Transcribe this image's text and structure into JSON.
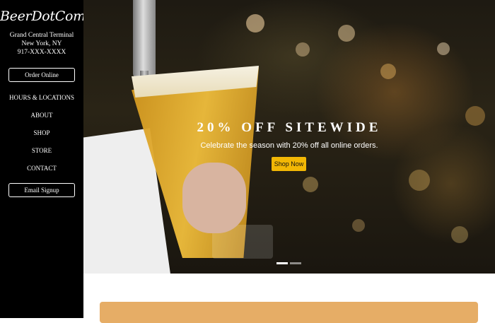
{
  "sidebar": {
    "logo": "BeerDotCom",
    "address_line1": "Grand Central Terminal",
    "address_line2": "New York, NY",
    "phone": "917-XXX-XXXX",
    "order_button": "Order Online",
    "nav": [
      {
        "label": "HOURS & LOCATIONS"
      },
      {
        "label": "ABOUT"
      },
      {
        "label": "SHOP"
      },
      {
        "label": "STORE"
      },
      {
        "label": "CONTACT"
      }
    ],
    "email_button": "Email Signup"
  },
  "hero": {
    "title": "20% OFF SITEWIDE",
    "subtitle": "Celebrate the season with 20% off all online orders.",
    "cta": "Shop Now",
    "slide_count": 2,
    "active_slide": 1
  },
  "colors": {
    "sidebar_bg": "#000000",
    "cta_bg": "#f2b705",
    "promo_panel": "#e6ad66"
  }
}
